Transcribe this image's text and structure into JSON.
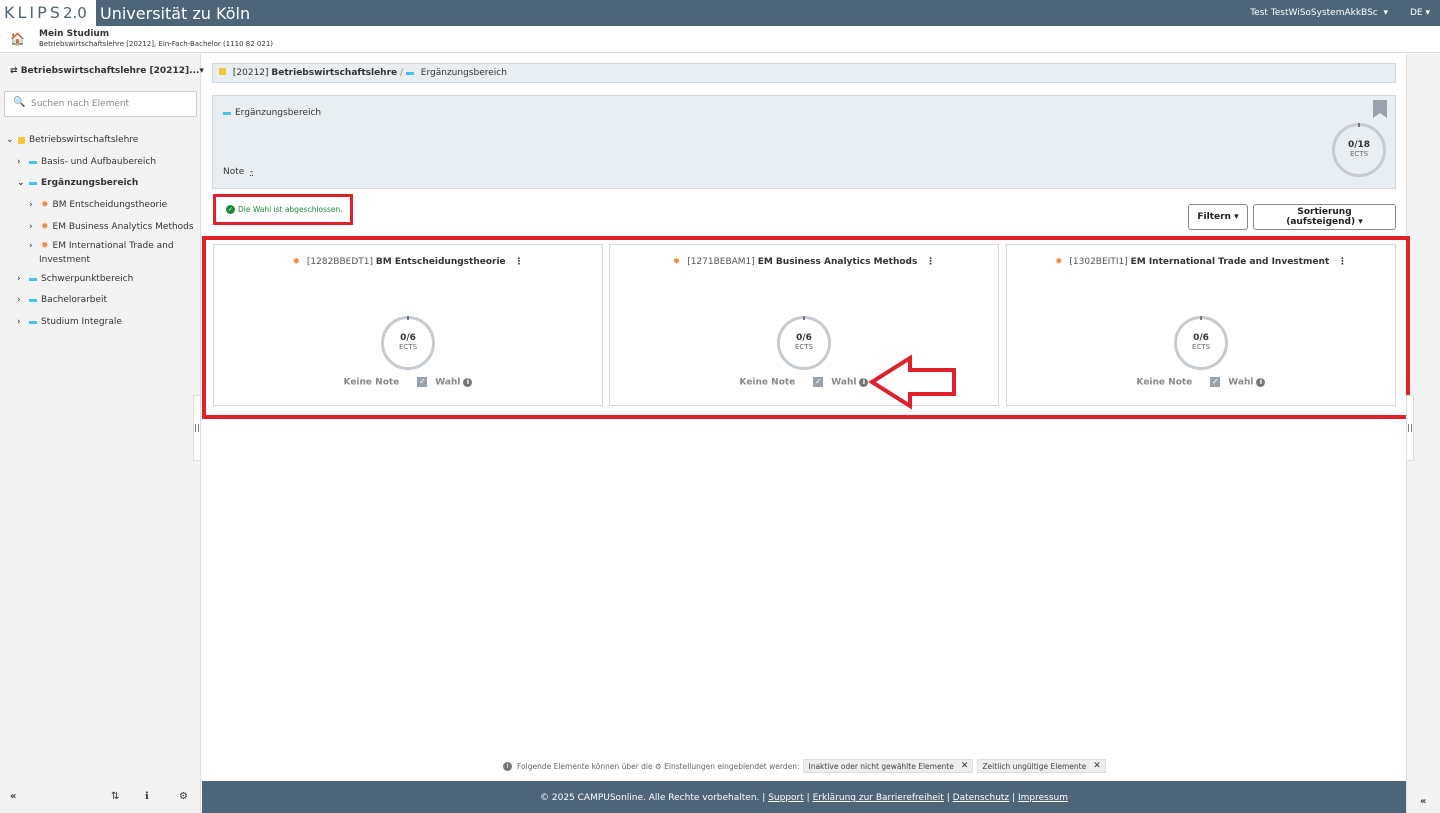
{
  "header": {
    "logo_text": "KLIPS",
    "logo_version": "2.0",
    "university": "Universität zu Köln",
    "user": "Test TestWiSoSystemAkkBSc",
    "user_caret": "▾",
    "language": "DE",
    "language_caret": "▾"
  },
  "study": {
    "home_icon": "🏠",
    "title": "Mein Studium",
    "subtitle": "Betriebswirtschaftslehre [20212], Ein-Fach-Bachelor (1110 82 021)"
  },
  "sidebar": {
    "selector_icon": "⇄",
    "selector_label": "Betriebswirtschaftslehre [20212]...",
    "selector_caret": "▾",
    "search_icon": "🔍",
    "search_placeholder": "Suchen nach Element",
    "tree": {
      "root": {
        "chev": "⌄",
        "label": "Betriebswirtschaftslehre"
      },
      "basis": {
        "chev": "›",
        "label": "Basis- und Aufbaubereich"
      },
      "ergaenzung": {
        "chev": "⌄",
        "label": "Ergänzungsbereich"
      },
      "bm_ent": {
        "chev": "›",
        "star": "✸",
        "label": "BM Entscheidungstheorie"
      },
      "em_bam": {
        "chev": "›",
        "star": "✸",
        "label": "EM Business Analytics Methods"
      },
      "em_iti_1": {
        "chev": "›",
        "star": "✸",
        "label": "EM International Trade and"
      },
      "em_iti_2": {
        "label": "Investment"
      },
      "schwerpunkt": {
        "chev": "›",
        "label": "Schwerpunktbereich"
      },
      "bachelor": {
        "chev": "›",
        "label": "Bachelorarbeit"
      },
      "integrale": {
        "chev": "›",
        "label": "Studium Integrale"
      }
    },
    "bottom": {
      "collapse": "«",
      "sort": "⇅",
      "info": "ℹ",
      "settings": "⚙"
    }
  },
  "breadcrumb": {
    "code": "[20212]",
    "name": "Betriebswirtschaftslehre",
    "separator": "/",
    "current": "Ergänzungsbereich"
  },
  "infobox": {
    "title": "Ergänzungsbereich",
    "note_label": "Note",
    "note_value": "-",
    "ects_value": "0/18",
    "ects_unit": "ECTS"
  },
  "status": {
    "icon": "✓",
    "text": "Die Wahl ist abgeschlossen."
  },
  "toolbar": {
    "filter_label": "Filtern ▾",
    "sort_label": "Sortierung (aufsteigend) ▾"
  },
  "cards": [
    {
      "star": "✸",
      "code": "[1282BBEDT1]",
      "name": "BM Entscheidungstheorie",
      "menu": "⋮",
      "ects_value": "0/6",
      "ects_unit": "ECTS",
      "grade": "Keine Note",
      "check": "✓",
      "choice": "Wahl",
      "info": "i"
    },
    {
      "star": "✸",
      "code": "[1271BEBAM1]",
      "name": "EM Business Analytics Methods",
      "menu": "⋮",
      "ects_value": "0/6",
      "ects_unit": "ECTS",
      "grade": "Keine Note",
      "check": "✓",
      "choice": "Wahl",
      "info": "i"
    },
    {
      "star": "✸",
      "code": "[1302BEITI1]",
      "name": "EM International Trade and Investment",
      "menu": "⋮",
      "ects_value": "0/6",
      "ects_unit": "ECTS",
      "grade": "Keine Note",
      "check": "✓",
      "choice": "Wahl",
      "info": "i"
    }
  ],
  "handles": {
    "left": "||",
    "right": "||"
  },
  "hint": {
    "info_icon": "i",
    "text_before": "Folgende Elemente können über die",
    "gear_icon": "⚙",
    "text_after": "Einstellungen eingeblendet werden:",
    "chip1": "Inaktive oder nicht gewählte Elemente",
    "chip2": "Zeitlich ungültige Elemente",
    "chip_close": "✕"
  },
  "footer": {
    "copyright": "© 2025 CAMPUSonline. Alle Rechte vorbehalten.",
    "sep": "|",
    "support": "Support",
    "accessibility": "Erklärung zur Barrierefreiheit",
    "privacy": "Datenschutz",
    "imprint": "Impressum"
  },
  "right_strip": {
    "collapse": "«"
  }
}
